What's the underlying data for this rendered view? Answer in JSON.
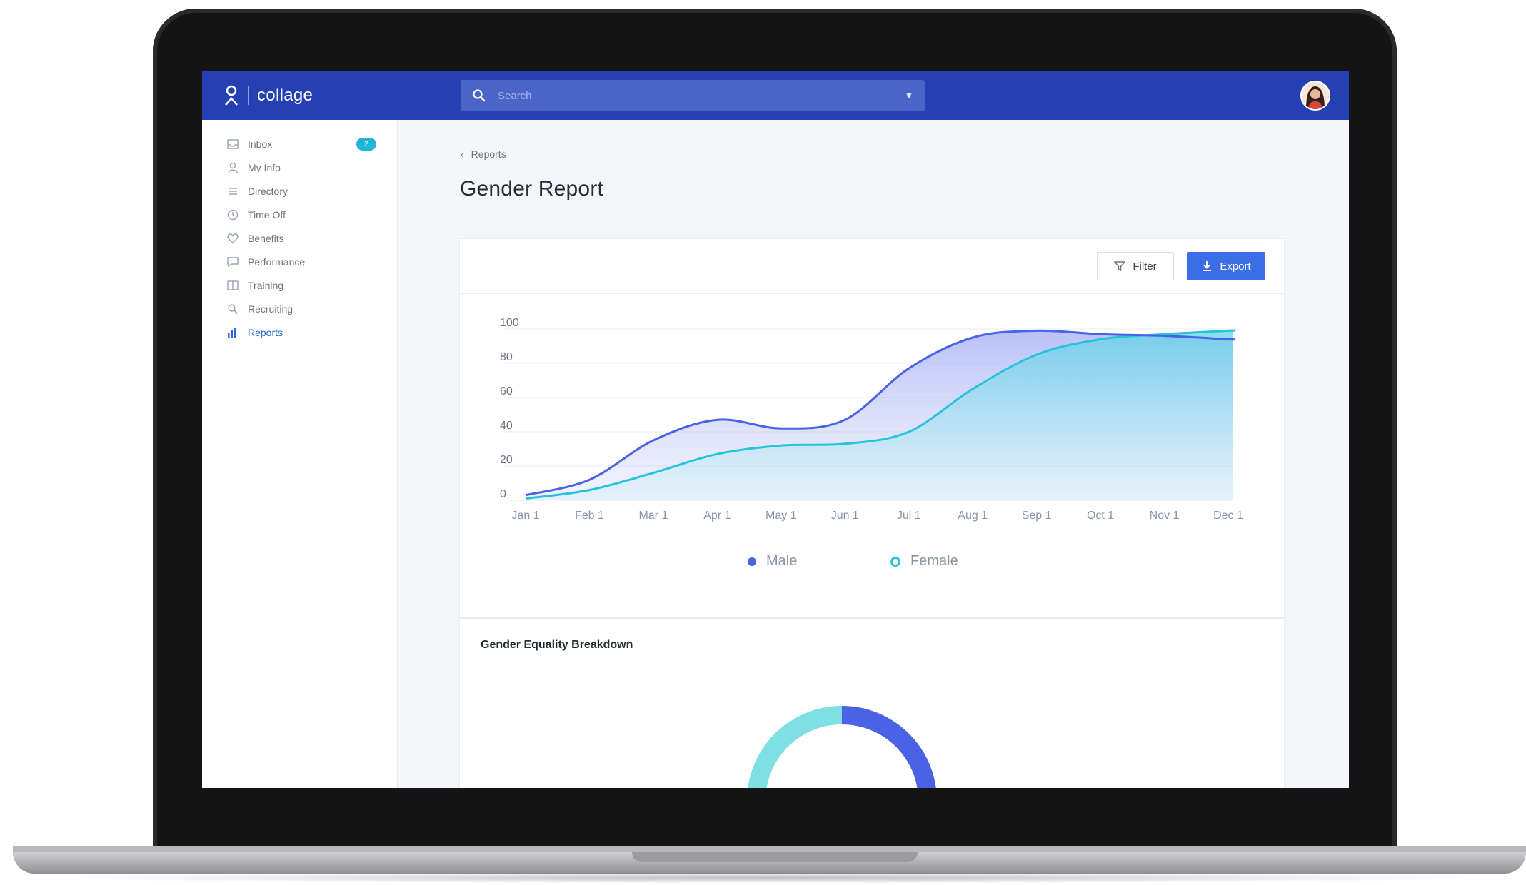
{
  "app": {
    "name": "collage"
  },
  "search": {
    "placeholder": "Search"
  },
  "sidebar": {
    "items": [
      {
        "label": "Inbox",
        "icon": "inbox-icon",
        "badge": "2"
      },
      {
        "label": "My Info",
        "icon": "user-icon"
      },
      {
        "label": "Directory",
        "icon": "list-icon"
      },
      {
        "label": "Time Off",
        "icon": "clock-icon"
      },
      {
        "label": "Benefits",
        "icon": "heart-icon"
      },
      {
        "label": "Performance",
        "icon": "chat-icon"
      },
      {
        "label": "Training",
        "icon": "book-icon"
      },
      {
        "label": "Recruiting",
        "icon": "search-icon"
      },
      {
        "label": "Reports",
        "icon": "bar-chart-icon",
        "active": true
      }
    ]
  },
  "breadcrumb": {
    "label": "Reports"
  },
  "page": {
    "title": "Gender Report"
  },
  "toolbar": {
    "filter_label": "Filter",
    "export_label": "Export"
  },
  "colors": {
    "brand": "#2440b3",
    "male": "#4a63e6",
    "female": "#26c3dc",
    "accent": "#3b6ee6"
  },
  "chart_data": {
    "type": "area",
    "x": [
      "Jan 1",
      "Feb 1",
      "Mar 1",
      "Apr 1",
      "May 1",
      "Jun 1",
      "Jul 1",
      "Aug 1",
      "Sep 1",
      "Oct 1",
      "Nov 1",
      "Dec 1"
    ],
    "ylim": [
      0,
      100
    ],
    "yticks": [
      0,
      20,
      40,
      60,
      80,
      100
    ],
    "grid": true,
    "legend": "bottom",
    "series": [
      {
        "name": "Male",
        "values": [
          3,
          12,
          35,
          47,
          42,
          47,
          77,
          95,
          99,
          97,
          96,
          94
        ]
      },
      {
        "name": "Female",
        "values": [
          1,
          6,
          16,
          27,
          32,
          33,
          40,
          65,
          85,
          94,
          97,
          99
        ]
      }
    ]
  },
  "breakdown": {
    "title": "Gender Equality Breakdown",
    "chart_data": {
      "type": "pie",
      "categories": [
        "Male",
        "Female"
      ],
      "values": [
        55,
        45
      ]
    }
  }
}
